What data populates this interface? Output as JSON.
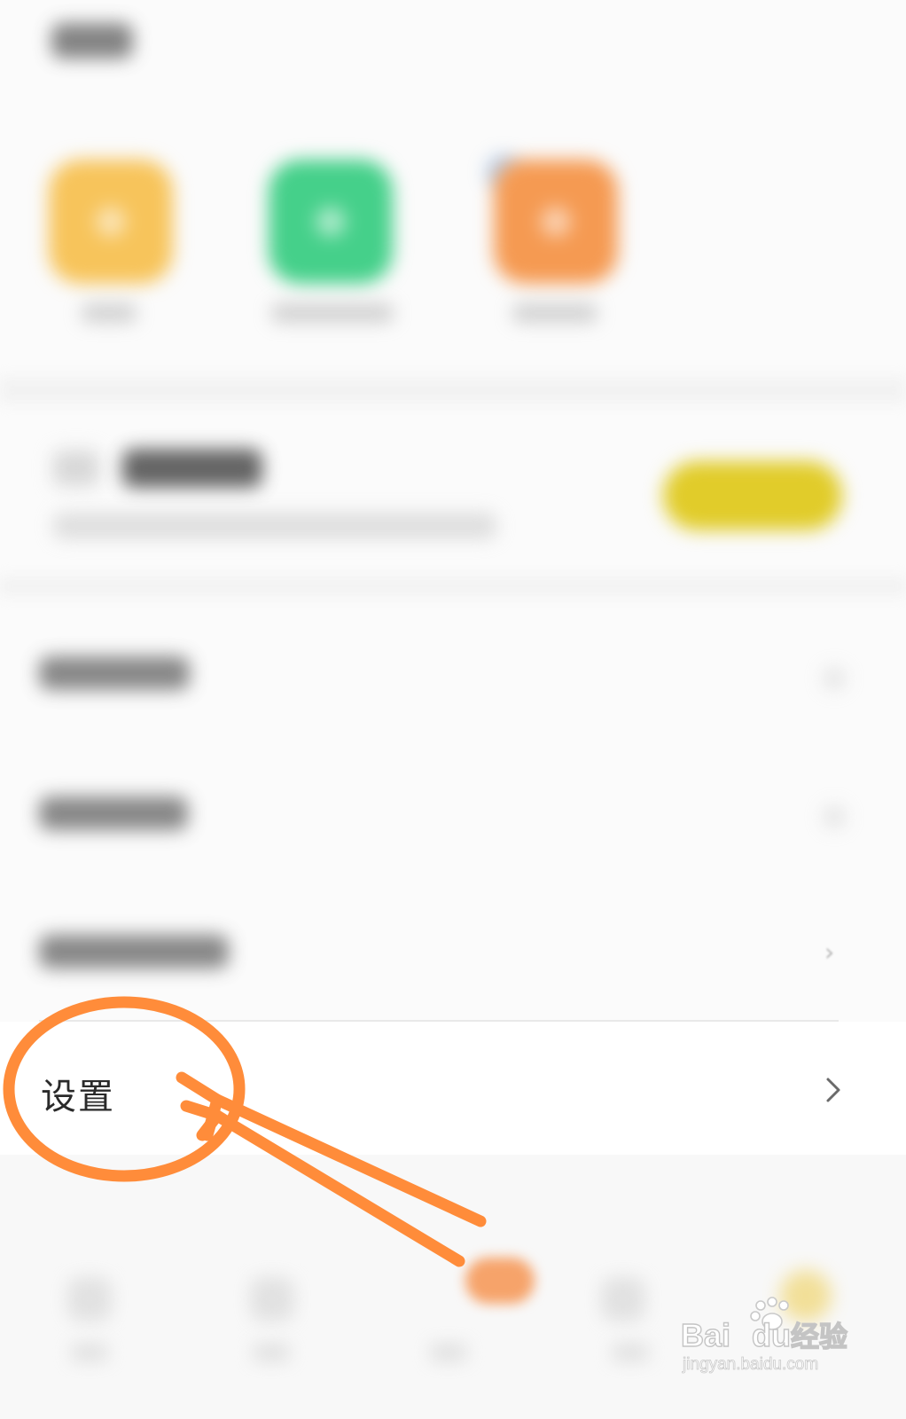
{
  "settings_row": {
    "label": "设置"
  },
  "menu": {
    "chevron_glyph": "›"
  },
  "watermark": {
    "brand_left": "Bai",
    "brand_right": "du",
    "product": "经验",
    "url": "jingyan.baidu.com"
  },
  "colors": {
    "annotation_orange": "#ff8c3a",
    "promo_button": "#e1cc2a",
    "app_1": "#f7c45b",
    "app_2": "#45d08a",
    "app_3": "#f59a52"
  },
  "icons": {
    "settings_chevron": "chevron-right-icon",
    "annotation_circle": "highlight-circle",
    "annotation_arrow": "pointer-arrow"
  }
}
